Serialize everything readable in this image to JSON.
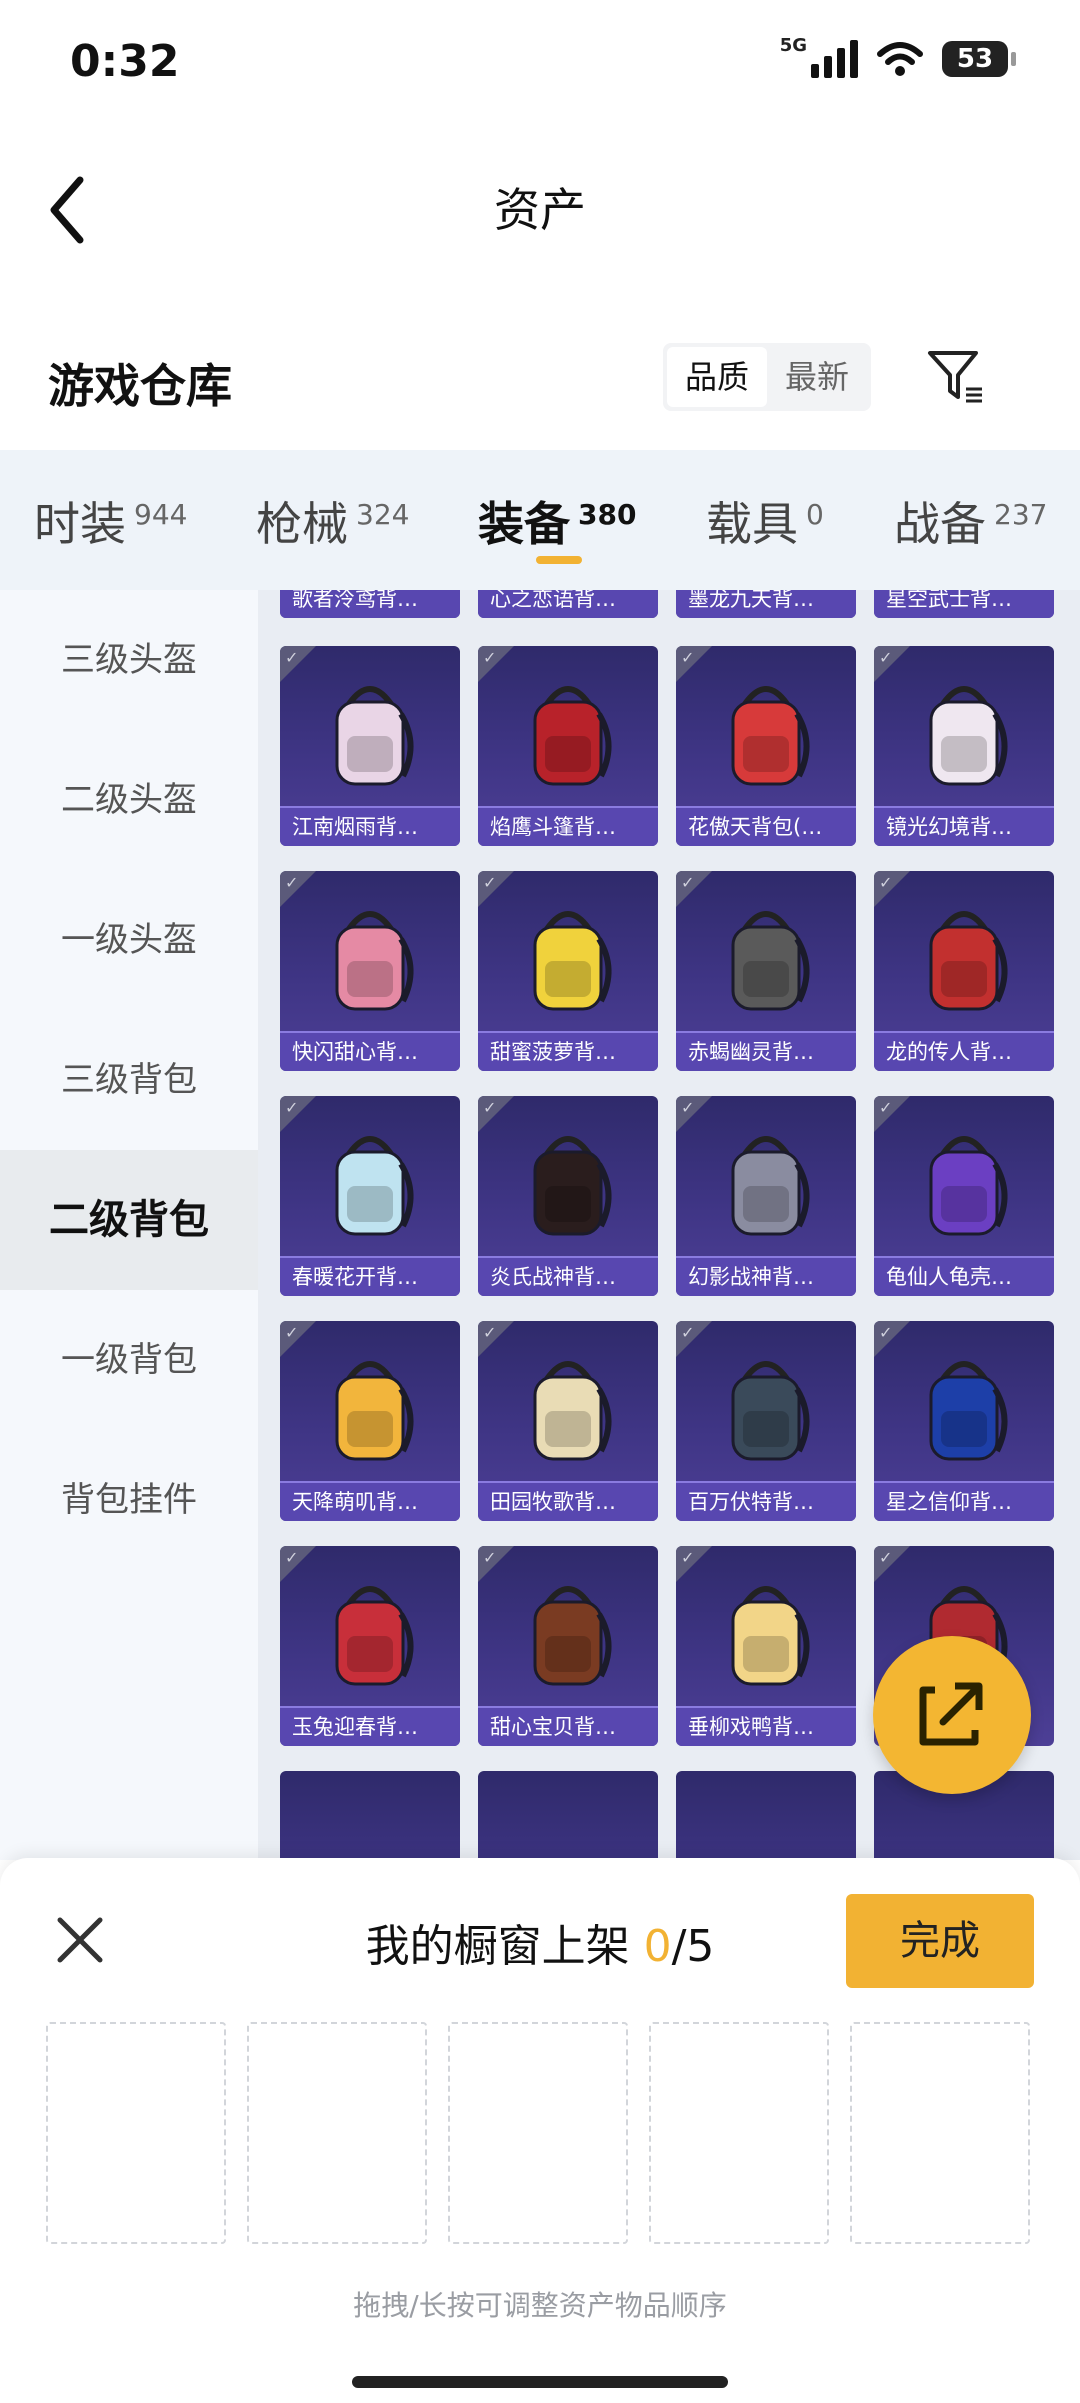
{
  "status_bar": {
    "time": "0:32",
    "network": "5G",
    "battery": "53"
  },
  "header": {
    "title": "资产"
  },
  "section": {
    "title": "游戏仓库",
    "sort_options": [
      "品质",
      "最新"
    ],
    "sort_active": "品质"
  },
  "tabs": [
    {
      "label": "时装",
      "count": "944"
    },
    {
      "label": "枪械",
      "count": "324"
    },
    {
      "label": "装备",
      "count": "380"
    },
    {
      "label": "载具",
      "count": "0"
    },
    {
      "label": "战备",
      "count": "237"
    }
  ],
  "tabs_active": "装备",
  "sidebar": {
    "items": [
      "三级头盔",
      "二级头盔",
      "一级头盔",
      "三级背包",
      "二级背包",
      "一级背包",
      "背包挂件"
    ],
    "active": "二级背包"
  },
  "grid": {
    "partial_top": [
      "歌者泠鸢背…",
      "心之恋语背…",
      "墨龙九天背…",
      "星空武士背…"
    ],
    "rows": [
      [
        "江南烟雨背…",
        "焰鹰斗篷背…",
        "花傲天背包(…",
        "镜光幻境背…"
      ],
      [
        "快闪甜心背…",
        "甜蜜菠萝背…",
        "赤蝎幽灵背…",
        "龙的传人背…"
      ],
      [
        "春暖花开背…",
        "炎氏战神背…",
        "幻影战神背…",
        "龟仙人龟壳…"
      ],
      [
        "天降萌叽背…",
        "田园牧歌背…",
        "百万伏特背…",
        "星之信仰背…"
      ],
      [
        "玉兔迎春背…",
        "甜心宝贝背…",
        "垂柳戏鸭背…",
        ""
      ]
    ],
    "pack_colors": [
      [
        "#e9d5e6",
        "#b8222a",
        "#d73a3a",
        "#efe7f0"
      ],
      [
        "#e58aa4",
        "#f0d23c",
        "#5a5a5a",
        "#c2302f"
      ],
      [
        "#bfe3f0",
        "#2a1d1d",
        "#8a8ca0",
        "#6b3fc2"
      ],
      [
        "#f2b53c",
        "#e9dcb5",
        "#3a4a5a",
        "#1d3fa8"
      ],
      [
        "#c82f3a",
        "#7a3b22",
        "#f2d588",
        "#b02a30"
      ]
    ]
  },
  "sheet": {
    "title": "我的橱窗上架",
    "current": "0",
    "total": "/5",
    "done_label": "完成",
    "hint": "拖拽/长按可调整资产物品顺序"
  },
  "colors": {
    "accent": "#f2b233",
    "card_bg": "#3f3585",
    "card_label": "#5847b0"
  },
  "icons": {
    "back": "chevron-left-icon",
    "filter": "filter-icon",
    "close": "close-icon",
    "fab": "share-external-icon"
  }
}
